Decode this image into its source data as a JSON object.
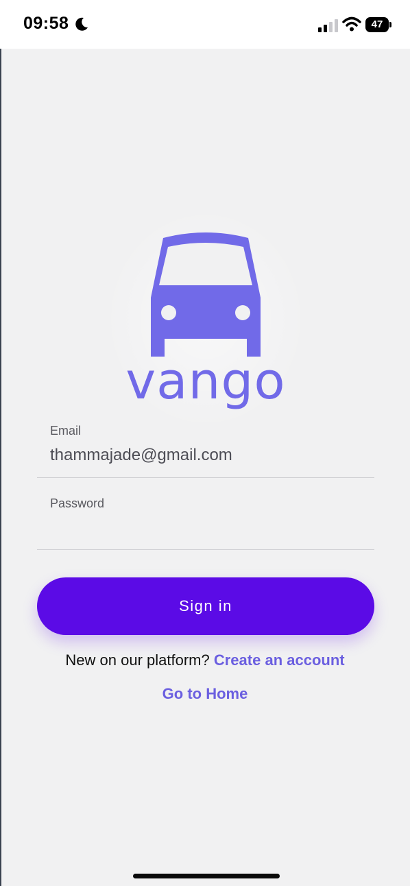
{
  "status_bar": {
    "time": "09:58",
    "battery": "47"
  },
  "logo": {
    "wordmark": "vango",
    "color": "#716ae8"
  },
  "form": {
    "email_label": "Email",
    "email_value": "thammajade@gmail.com",
    "password_label": "Password",
    "password_value": ""
  },
  "actions": {
    "signin_label": "Sign in",
    "signup_prompt": "New on our platform?",
    "signup_link": "Create an account",
    "home_link": "Go to Home"
  },
  "colors": {
    "primary": "#5b0be6",
    "link": "#6b5fe0",
    "background": "#f1f1f2"
  }
}
